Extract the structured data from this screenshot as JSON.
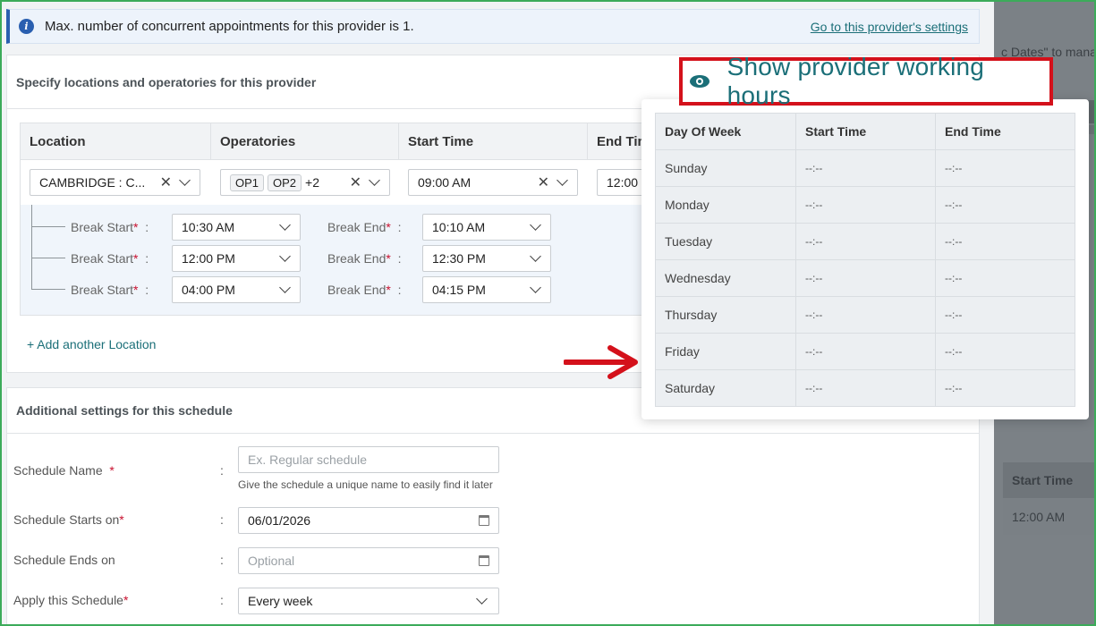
{
  "banner": {
    "text": "Max. number of concurrent appointments for this provider is 1.",
    "link": "Go to this provider's settings"
  },
  "locations_card": {
    "title": "Specify locations and operatories for this provider",
    "columns": [
      "Location",
      "Operatories",
      "Start Time",
      "End Time"
    ],
    "row": {
      "location": "CAMBRIDGE : C...",
      "operatories": [
        "OP1",
        "OP2"
      ],
      "operatories_more": "+2",
      "start_time": "09:00 AM",
      "end_time": "12:00"
    },
    "breaks": [
      {
        "start_label": "Break Start",
        "start": "10:30 AM",
        "end_label": "Break End",
        "end": "10:10 AM"
      },
      {
        "start_label": "Break Start",
        "start": "12:00 PM",
        "end_label": "Break End",
        "end": "12:30 PM"
      },
      {
        "start_label": "Break Start",
        "start": "04:00 PM",
        "end_label": "Break End",
        "end": "04:15 PM"
      }
    ],
    "add_location": "+ Add another Location"
  },
  "additional_card": {
    "title": "Additional settings for this schedule",
    "schedule_name": {
      "label": "Schedule Name",
      "placeholder": "Ex. Regular schedule",
      "hint": "Give the schedule a unique name to easily find it later"
    },
    "schedule_starts": {
      "label": "Schedule Starts on",
      "value": "06/01/2026"
    },
    "schedule_ends": {
      "label": "Schedule Ends on",
      "placeholder": "Optional"
    },
    "apply": {
      "label": "Apply this Schedule",
      "value": "Every week"
    }
  },
  "show_hours_button": "Show provider working hours",
  "working_hours": {
    "headers": [
      "Day Of Week",
      "Start Time",
      "End Time"
    ],
    "rows": [
      {
        "day": "Sunday",
        "start": "--:--",
        "end": "--:--"
      },
      {
        "day": "Monday",
        "start": "--:--",
        "end": "--:--"
      },
      {
        "day": "Tuesday",
        "start": "--:--",
        "end": "--:--"
      },
      {
        "day": "Wednesday",
        "start": "--:--",
        "end": "--:--"
      },
      {
        "day": "Thursday",
        "start": "--:--",
        "end": "--:--"
      },
      {
        "day": "Friday",
        "start": "--:--",
        "end": "--:--"
      },
      {
        "day": "Saturday",
        "start": "--:--",
        "end": "--:--"
      }
    ]
  },
  "background": {
    "partial_text": "c Dates\" to mana",
    "column": "Start Time",
    "cell": "12:00 AM"
  },
  "colors": {
    "accent": "#1b6f78",
    "highlight": "#d4111b",
    "required": "#c8102e",
    "frame": "#3cab5a"
  }
}
